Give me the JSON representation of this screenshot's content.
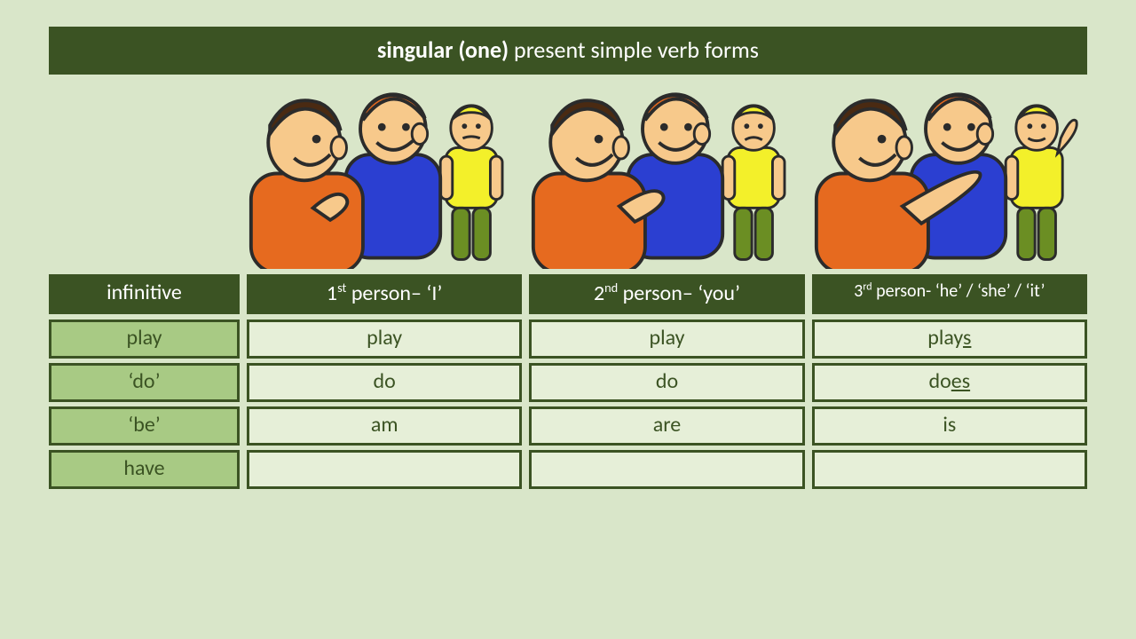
{
  "title": {
    "bold": "singular (one)",
    "rest": " present simple verb forms"
  },
  "headers": {
    "infinitive": "infinitive",
    "first": {
      "ord": "1",
      "sup": "st",
      "tail": " person– ‘I’"
    },
    "second": {
      "ord": "2",
      "sup": "nd",
      "tail": " person– ‘you’"
    },
    "third": {
      "ord": "3",
      "sup": "rd",
      "tail": " person- ‘he’ / ‘she’ / ‘it’"
    }
  },
  "rows": [
    {
      "inf": "play",
      "first": "play",
      "second": "play",
      "third_pre": "play",
      "third_u": "s",
      "third_post": ""
    },
    {
      "inf": "‘do’",
      "first": "do",
      "second": "do",
      "third_pre": "do",
      "third_u": "es",
      "third_post": ""
    },
    {
      "inf": "‘be’",
      "first": "am",
      "second": "are",
      "third_pre": "is",
      "third_u": "",
      "third_post": ""
    },
    {
      "inf": "have",
      "first": "",
      "second": "",
      "third_pre": "",
      "third_u": "",
      "third_post": ""
    }
  ]
}
